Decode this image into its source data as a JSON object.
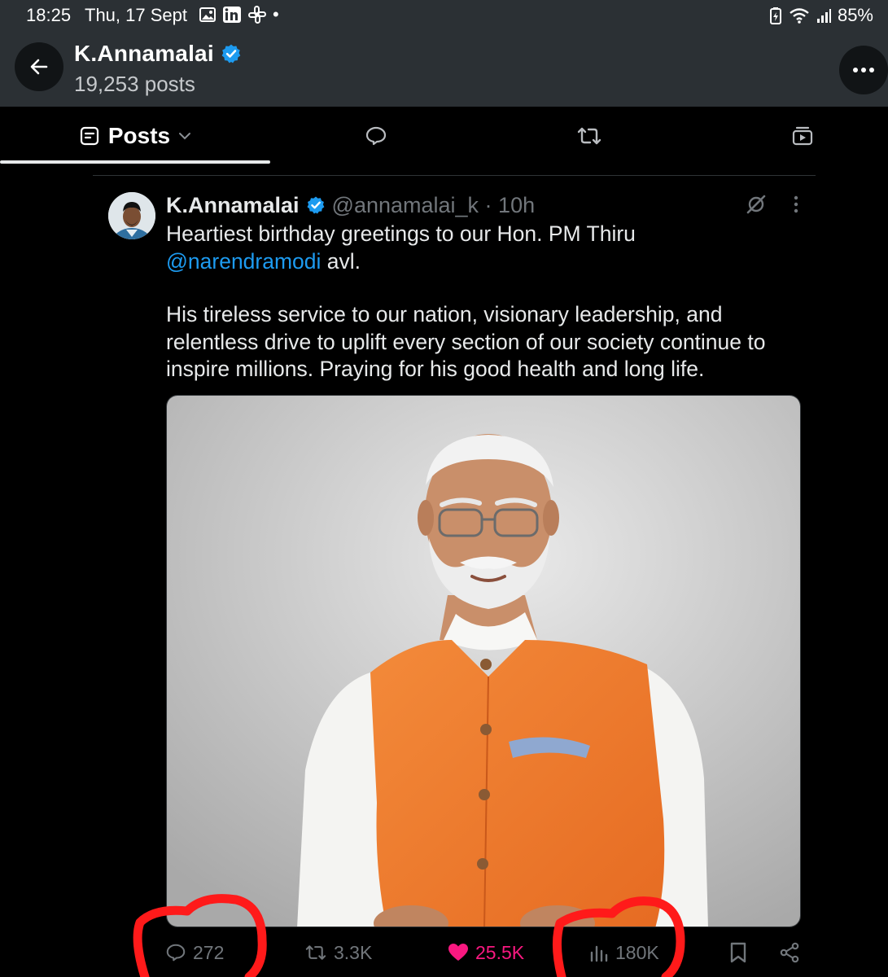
{
  "status_bar": {
    "time": "18:25",
    "date": "Thu, 17 Sept",
    "battery": "85%"
  },
  "header": {
    "title": "K.Annamalai",
    "posts_count": "19,253 posts",
    "verified_color": "#1d9bf0"
  },
  "tabs": [
    {
      "label": "Posts",
      "icon": "posts-icon",
      "active": true
    },
    {
      "icon": "replies-icon"
    },
    {
      "icon": "reposts-icon"
    },
    {
      "icon": "media-icon"
    }
  ],
  "tweet": {
    "author_name": "K.Annamalai",
    "handle_time": "@annamalai_k · 10h",
    "text_line1": "Heartiest birthday greetings to our Hon. PM Thiru",
    "mention": "@narendramodi",
    "text_after_mention": " avl.",
    "text_para2": "His tireless service to our nation, visionary leadership, and relentless drive to uplift every section of our society continue to inspire millions. Praying for his good health and long life.",
    "stats": {
      "replies": "272",
      "reposts": "3.3K",
      "likes": "25.5K",
      "views": "180K"
    }
  },
  "colors": {
    "accent": "#1d9bf0",
    "like": "#f91880",
    "annotation": "#ff1a1a",
    "vest": "#f07a2c"
  }
}
